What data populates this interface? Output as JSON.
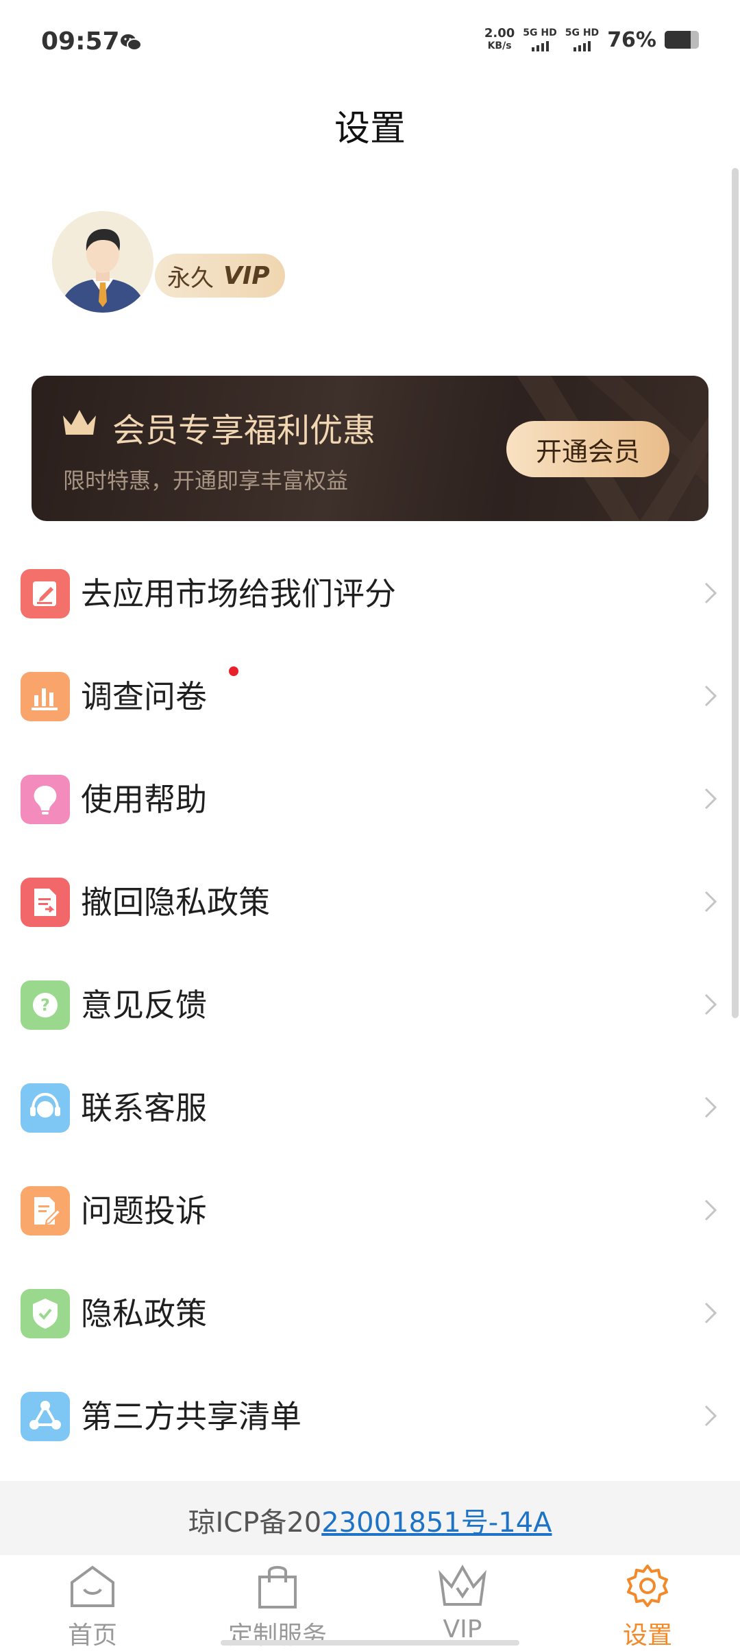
{
  "status_bar": {
    "time": "09:57",
    "speed_value": "2.00",
    "speed_unit": "KB/s",
    "sim1_label": "5G HD",
    "sim2_label": "5G HD",
    "battery_percent": "76%",
    "battery_level": 0.76
  },
  "header": {
    "title": "设置"
  },
  "profile": {
    "badge_prefix": "永久",
    "badge_vip": "VIP"
  },
  "member_banner": {
    "title": "会员专享福利优惠",
    "subtitle": "限时特惠，开通即享丰富权益",
    "button_label": "开通会员"
  },
  "menu": {
    "items": [
      {
        "label": "去应用市场给我们评分",
        "icon": "edit-icon",
        "color": "#f4706a",
        "has_dot": false
      },
      {
        "label": "调查问卷",
        "icon": "bar-chart-icon",
        "color": "#f9a46a",
        "has_dot": true
      },
      {
        "label": "使用帮助",
        "icon": "bulb-icon",
        "color": "#f38cbd",
        "has_dot": false
      },
      {
        "label": "撤回隐私政策",
        "icon": "document-return-icon",
        "color": "#f2686a",
        "has_dot": false
      },
      {
        "label": "意见反馈",
        "icon": "question-icon",
        "color": "#9ad88d",
        "has_dot": false
      },
      {
        "label": "联系客服",
        "icon": "headset-icon",
        "color": "#7ec6f3",
        "has_dot": false
      },
      {
        "label": "问题投诉",
        "icon": "complaint-icon",
        "color": "#f9a76b",
        "has_dot": false
      },
      {
        "label": "隐私政策",
        "icon": "shield-check-icon",
        "color": "#9ad88d",
        "has_dot": false
      },
      {
        "label": "第三方共享清单",
        "icon": "share-icon",
        "color": "#7ec6f3",
        "has_dot": false
      }
    ]
  },
  "icp": {
    "prefix": "琼ICP备20",
    "link": "23001851号-14A"
  },
  "bottom_nav": {
    "tabs": [
      {
        "label": "首页",
        "icon": "home-icon",
        "active": false
      },
      {
        "label": "定制服务",
        "icon": "shopping-bag-icon",
        "active": false
      },
      {
        "label": "VIP",
        "icon": "crown-icon",
        "active": false
      },
      {
        "label": "设置",
        "icon": "gear-icon",
        "active": true
      }
    ],
    "active_color": "#f28a2a",
    "inactive_color": "#999999"
  }
}
